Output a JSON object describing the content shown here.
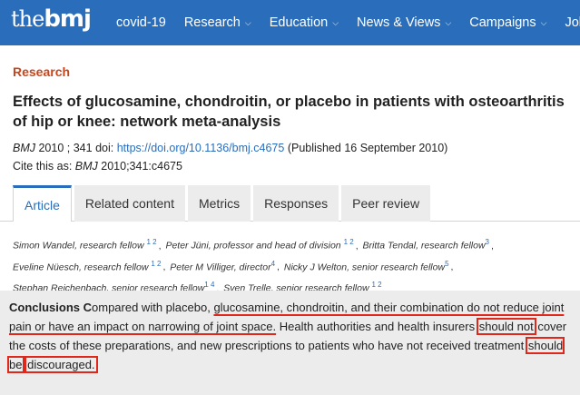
{
  "nav": {
    "logo_the": "the",
    "logo_bmj": "bmj",
    "items": [
      {
        "label": "covid-19"
      },
      {
        "label": "Research",
        "chevron": "chevron-down-icon"
      },
      {
        "label": "Education",
        "chevron": "chevron-down-icon"
      },
      {
        "label": "News & Views",
        "chevron": "chevron-down-icon"
      },
      {
        "label": "Campaigns",
        "chevron": "chevron-down-icon"
      },
      {
        "label": "Jobs",
        "chevron": "chevron-down-icon"
      }
    ]
  },
  "article": {
    "section": "Research",
    "title": "Effects of glucosamine, chondroitin, or placebo in patients with osteoarthritis of hip or knee: network meta-analysis",
    "journal": "BMJ",
    "year_vol": "2010 ; 341",
    "doi_label": "doi:",
    "doi_link": "https://doi.org/10.1136/bmj.c4675",
    "published": "(Published 16 September 2010)",
    "cite_prefix": "Cite this as:",
    "cite_journal": "BMJ",
    "cite_ref": "2010;341:c4675"
  },
  "tabs": [
    {
      "label": "Article",
      "active": true
    },
    {
      "label": "Related content"
    },
    {
      "label": "Metrics"
    },
    {
      "label": "Responses"
    },
    {
      "label": "Peer review"
    }
  ],
  "authors": [
    {
      "name": "Simon Wandel, research fellow",
      "sup": "1 2"
    },
    {
      "name": "Peter Jüni, professor and head of division",
      "sup": "1 2"
    },
    {
      "name": "Britta Tendal, research fellow",
      "sup": "3"
    },
    {
      "name": "Eveline Nüesch, research fellow",
      "sup": "1 2"
    },
    {
      "name": "Peter M Villiger, director",
      "sup": "4"
    },
    {
      "name": "Nicky J Welton, senior research fellow",
      "sup": "5"
    },
    {
      "name": "Stephan Reichenbach, senior research fellow",
      "sup": "1 4"
    },
    {
      "name": "Sven Trelle, senior research fellow",
      "sup": "1 2"
    }
  ],
  "conclusions": {
    "heading": "Conclusions C",
    "t1": "ompared with placebo, ",
    "u1": "glucosamine, chondroitin, and their combination do not reduce joint pain or have an impact on narrowing of joint space.",
    "t2": " Health authorities and health insurers ",
    "b1": "should not",
    "t3": " cover the costs of these preparations, and new prescriptions to patients who have not received treatment ",
    "b2": "should be",
    "t4": " ",
    "b3": "discouraged.",
    "highlight_color": "#e0271b"
  }
}
